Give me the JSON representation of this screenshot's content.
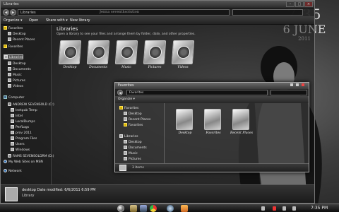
{
  "background": {
    "date_time": "7:35",
    "date_day": "6 JUNE",
    "date_year": "2011"
  },
  "explorer": {
    "title": "Libraries",
    "address": "Libraries",
    "address_ghost": "Jenna seventhsolution",
    "toolbar": {
      "organize": "Organize ▾",
      "open": "Open",
      "share_with": "Share with ▾",
      "new_library": "New library"
    },
    "heading": "Libraries",
    "subheading": "Open a library to see your files and arrange them by folder, date, and other properties.",
    "nav": [
      {
        "label": "Favorites",
        "icon": "star-icon"
      },
      {
        "label": "Desktop",
        "icon": "desktop-icon"
      },
      {
        "label": "Recent Places",
        "icon": "recent-icon"
      },
      {
        "label": "Favorites",
        "icon": "star-icon"
      },
      {
        "label": "Libraries",
        "icon": "library-icon"
      },
      {
        "label": "Desktop",
        "icon": "desktop-icon"
      },
      {
        "label": "Documents",
        "icon": "documents-icon"
      },
      {
        "label": "Music",
        "icon": "music-icon"
      },
      {
        "label": "Pictures",
        "icon": "pictures-icon"
      },
      {
        "label": "Videos",
        "icon": "videos-icon"
      },
      {
        "label": "Computer",
        "icon": "computer-icon"
      },
      {
        "label": "ANDREW SEVENSOLD (C:)",
        "icon": "drive-icon"
      },
      {
        "label": "Inetpub Temp",
        "icon": "folder-icon"
      },
      {
        "label": "Intel",
        "icon": "folder-icon"
      },
      {
        "label": "LocalDumps",
        "icon": "folder-icon"
      },
      {
        "label": "PerfLogs",
        "icon": "folder-icon"
      },
      {
        "label": "prov 2011",
        "icon": "folder-icon"
      },
      {
        "label": "Program Files",
        "icon": "folder-icon"
      },
      {
        "label": "Users",
        "icon": "folder-icon"
      },
      {
        "label": "Windows",
        "icon": "folder-icon"
      },
      {
        "label": "RAMS SEVENSOLDRM (D:)",
        "icon": "drive-icon"
      },
      {
        "label": "My Web Sites on MSN",
        "icon": "web-icon"
      },
      {
        "label": "Network",
        "icon": "network-icon"
      }
    ],
    "libraries": [
      "Desktop",
      "Documents",
      "Music",
      "Pictures",
      "Videos"
    ],
    "details": {
      "name": "desktop  Date modified: 6/6/2011 6:59 PM",
      "kind": "Library"
    }
  },
  "favorites_window": {
    "title": "Favorites",
    "address": "Favorites",
    "toolbar": {
      "organize": "Organize ▾"
    },
    "nav": [
      {
        "label": "Favorites",
        "icon": "star-icon"
      },
      {
        "label": "Desktop",
        "icon": "desktop-icon"
      },
      {
        "label": "Recent Places",
        "icon": "recent-icon"
      },
      {
        "label": "Favorites",
        "icon": "star-icon"
      },
      {
        "label": "Libraries",
        "icon": "library-icon"
      },
      {
        "label": "Desktop",
        "icon": "desktop-icon"
      },
      {
        "label": "Documents",
        "icon": "documents-icon"
      },
      {
        "label": "Music",
        "icon": "music-icon"
      },
      {
        "label": "Pictures",
        "icon": "pictures-icon"
      }
    ],
    "items": [
      "Desktop",
      "Favorites",
      "Recent Places"
    ],
    "status": "3 items"
  },
  "taskbar": {
    "clock": "7:35 PM"
  }
}
